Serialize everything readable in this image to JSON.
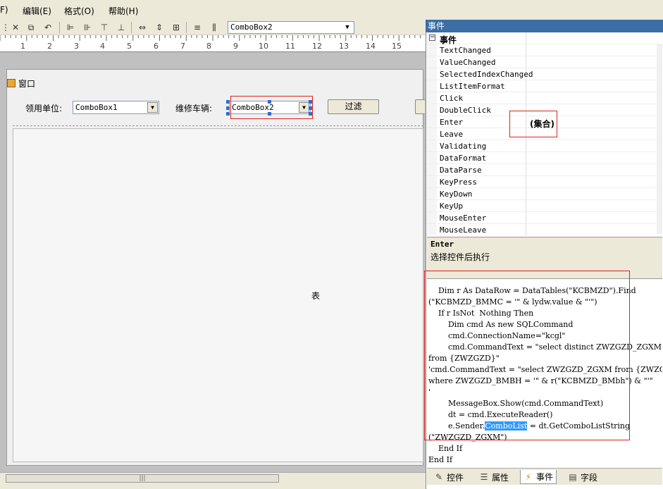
{
  "menu": [
    {
      "label": "F)"
    },
    {
      "label": "编辑(E)"
    },
    {
      "label": "格式(O)"
    },
    {
      "label": "帮助(H)"
    }
  ],
  "toolbar": {
    "combo_value": "ComboBox2",
    "icons": [
      "cut-icon",
      "copy-icon",
      "undo-icon",
      "align-left-icon",
      "align-right-icon",
      "align-top-icon",
      "align-bottom-icon",
      "same-width-icon",
      "same-height-icon",
      "same-size-icon",
      "vertical-spacing-icon",
      "horizontal-spacing-icon"
    ]
  },
  "ruler": {
    "numbers": [
      "1",
      "2",
      "3",
      "4",
      "5",
      "6",
      "7",
      "8",
      "9",
      "10",
      "11",
      "12",
      "13",
      "14",
      "15"
    ]
  },
  "form": {
    "title": "窗口",
    "label_unit": "领用单位:",
    "combo1_value": "ComboBox1",
    "label_vehicle": "维修车辆:",
    "combo2_value": "ComboBox2",
    "filter_button": "过滤",
    "table_label": "表"
  },
  "panel": {
    "title": "事件",
    "category": "事件",
    "events": [
      {
        "name": "TextChanged",
        "value": ""
      },
      {
        "name": "ValueChanged",
        "value": ""
      },
      {
        "name": "SelectedIndexChanged",
        "value": ""
      },
      {
        "name": "ListItemFormat",
        "value": ""
      },
      {
        "name": "Click",
        "value": ""
      },
      {
        "name": "DoubleClick",
        "value": ""
      },
      {
        "name": "Enter",
        "value": "(集合)"
      },
      {
        "name": "Leave",
        "value": ""
      },
      {
        "name": "Validating",
        "value": ""
      },
      {
        "name": "DataFormat",
        "value": ""
      },
      {
        "name": "DataParse",
        "value": ""
      },
      {
        "name": "KeyPress",
        "value": ""
      },
      {
        "name": "KeyDown",
        "value": ""
      },
      {
        "name": "KeyUp",
        "value": ""
      },
      {
        "name": "MouseEnter",
        "value": ""
      },
      {
        "name": "MouseLeave",
        "value": ""
      }
    ],
    "desc_title": "Enter",
    "desc_text": "选择控件后执行"
  },
  "code": {
    "lines": [
      "    Dim r As DataRow = DataTables(\"KCBMZD\").Find",
      "(\"KCBMZD_BMMC = '\" & lydw.value & \"'\")",
      "    If r IsNot  Nothing Then",
      "        Dim cmd As new SQLCommand",
      "        cmd.ConnectionName=\"kcgl\"",
      "        cmd.CommandText = \"select distinct ZWZGZD_ZGXM",
      "from {ZWZGZD}\"",
      "'cmd.CommandText = \"select ZWZGZD_ZGXM from {ZWZGZD}",
      "where ZWZGZD_BMBH = '\" & r(\"KCBMZD_BMbh\") & \"'\"",
      "'",
      "        MessageBox.Show(cmd.CommandText)",
      "        dt = cmd.ExecuteReader()",
      "        e.Sender.",
      "(\"ZWZGZD_ZGXM\")",
      "    End If",
      "End If"
    ],
    "selected_word": "ComboList",
    "after_selected": " = dt.GetComboListString"
  },
  "tabs": [
    {
      "label": "控件",
      "icon": "wrench-icon"
    },
    {
      "label": "属性",
      "icon": "properties-icon"
    },
    {
      "label": "事件",
      "icon": "lightning-icon"
    },
    {
      "label": "字段",
      "icon": "field-icon"
    }
  ],
  "colors": {
    "selection": "#3399ff",
    "highlight_box": "#e02020",
    "panel_title": "#3a6ea5"
  }
}
